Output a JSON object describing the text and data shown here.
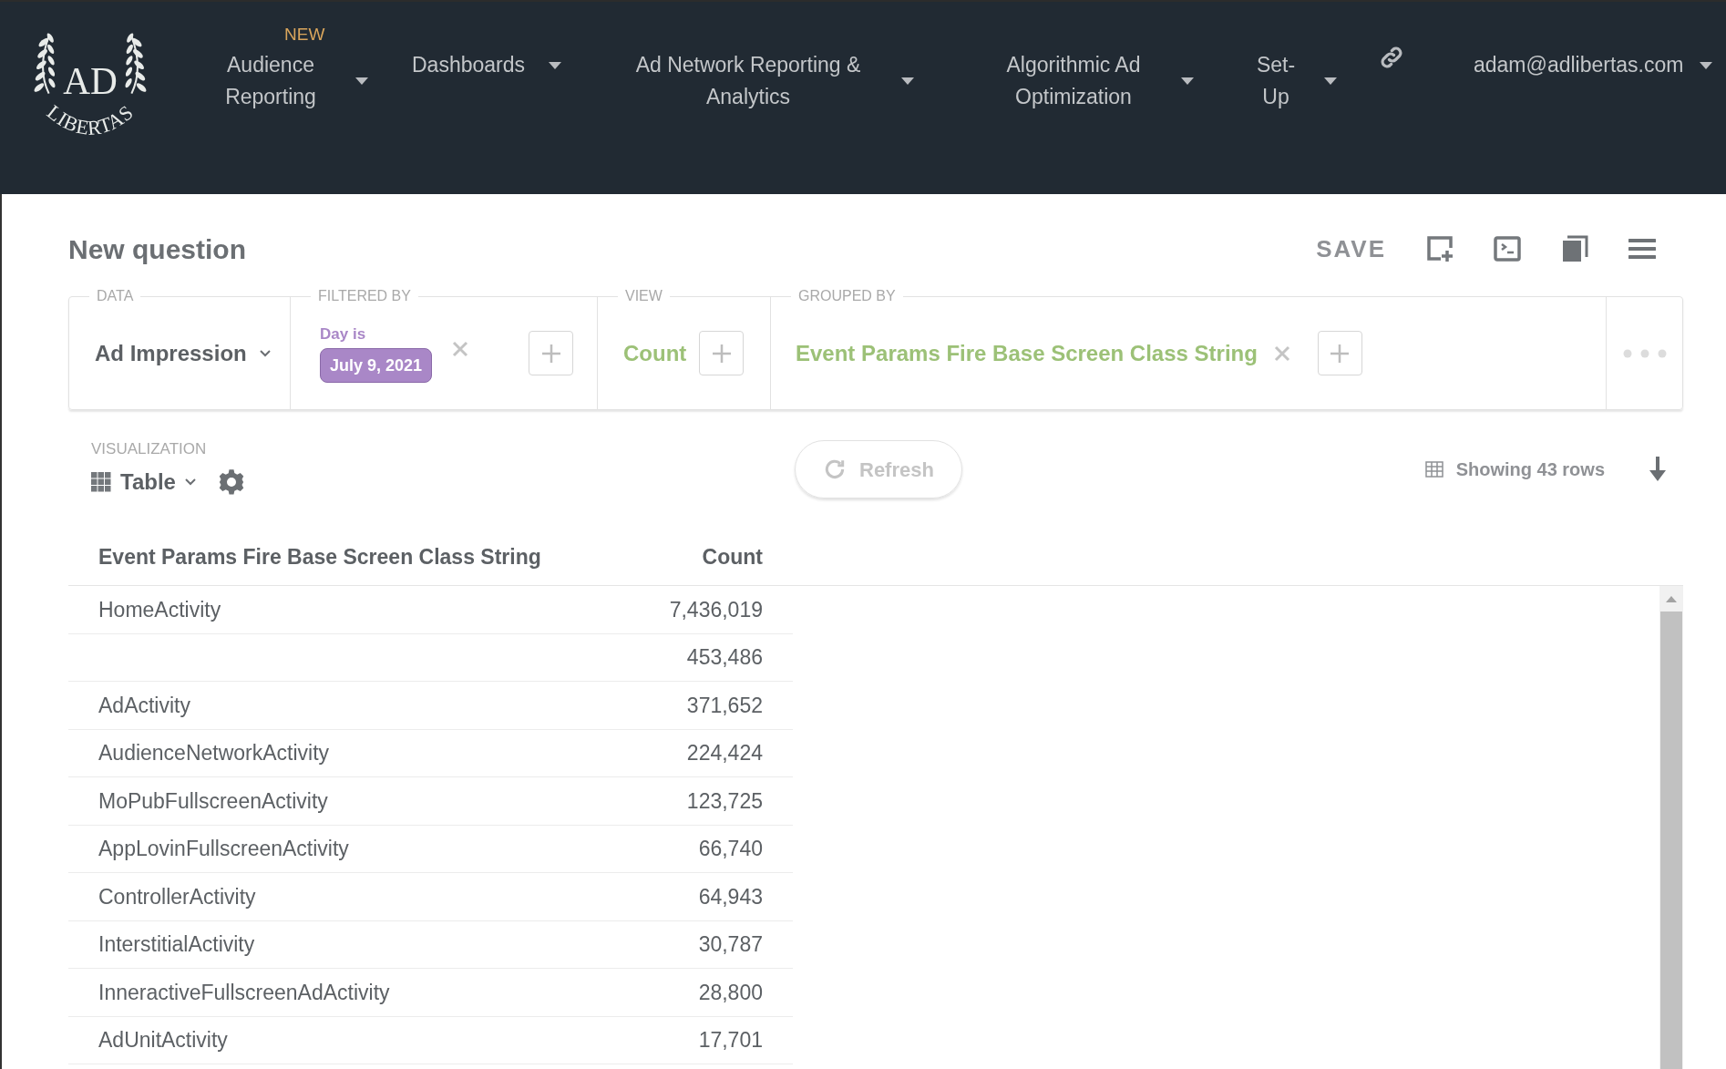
{
  "logo": {
    "top": "AD",
    "bottom": "LIBERTAS"
  },
  "nav": [
    {
      "label": "Audience Reporting",
      "badge": "NEW"
    },
    {
      "label": "Dashboards"
    },
    {
      "label": "Ad Network Reporting & Analytics"
    },
    {
      "label": "Algorithmic Ad Optimization"
    },
    {
      "label": "Set-Up"
    }
  ],
  "account": {
    "email": "adam@adlibertas.com"
  },
  "question": {
    "title": "New question",
    "save": "SAVE"
  },
  "query": {
    "data_label": "DATA",
    "source": "Ad Impression",
    "filter_label": "FILTERED BY",
    "filter_field": "Day is",
    "filter_value": "July 9, 2021",
    "view_label": "VIEW",
    "view_value": "Count",
    "group_label": "GROUPED BY",
    "group_value": "Event Params Fire Base Screen Class String"
  },
  "visualization": {
    "label": "VISUALIZATION",
    "type": "Table",
    "refresh": "Refresh",
    "row_count": "Showing 43 rows"
  },
  "table": {
    "columns": [
      "Event Params Fire Base Screen Class String",
      "Count"
    ],
    "rows": [
      [
        "HomeActivity",
        "7,436,019"
      ],
      [
        "",
        "453,486"
      ],
      [
        "AdActivity",
        "371,652"
      ],
      [
        "AudienceNetworkActivity",
        "224,424"
      ],
      [
        "MoPubFullscreenActivity",
        "123,725"
      ],
      [
        "AppLovinFullscreenActivity",
        "66,740"
      ],
      [
        "ControllerActivity",
        "64,943"
      ],
      [
        "InterstitialActivity",
        "30,787"
      ],
      [
        "InneractiveFullscreenAdActivity",
        "28,800"
      ],
      [
        "AdUnitActivity",
        "17,701"
      ]
    ]
  }
}
